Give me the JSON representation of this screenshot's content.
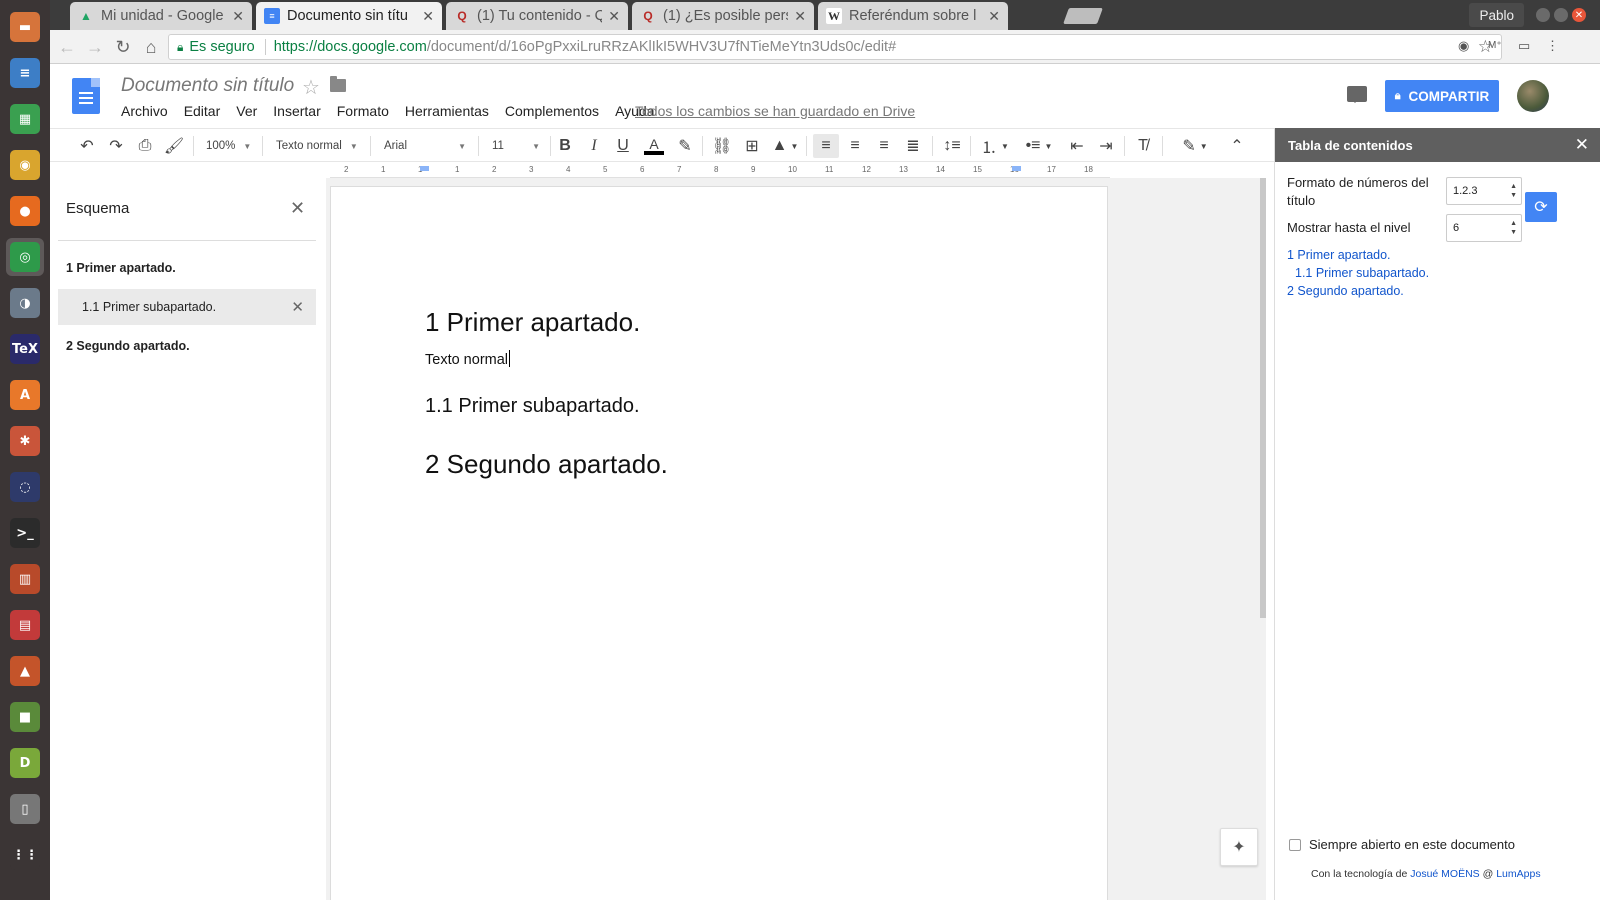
{
  "launcher": {
    "items": [
      {
        "icon": "files-icon",
        "glyph": "▬",
        "color": "#d6743b"
      },
      {
        "icon": "writer-icon",
        "glyph": "≡",
        "color": "#3d7ec6"
      },
      {
        "icon": "calc-icon",
        "glyph": "▦",
        "color": "#3aa050"
      },
      {
        "icon": "rhythmbox-icon",
        "glyph": "◉",
        "color": "#d9a52e"
      },
      {
        "icon": "firefox-icon",
        "glyph": "●",
        "color": "#e66a1f"
      },
      {
        "icon": "chrome-icon",
        "glyph": "◎",
        "color": "#2e9a4a"
      },
      {
        "icon": "earth-pro-icon",
        "glyph": "◑",
        "color": "#6b7a8a"
      },
      {
        "icon": "texmaker-icon",
        "glyph": "TeX",
        "color": "#2a2a6a"
      },
      {
        "icon": "software-center-icon",
        "glyph": "A",
        "color": "#e8782a"
      },
      {
        "icon": "settings-icon",
        "glyph": "✱",
        "color": "#c9553a"
      },
      {
        "icon": "geogebra-icon",
        "glyph": "◌",
        "color": "#2e3a6a"
      },
      {
        "icon": "terminal-icon",
        "glyph": ">_",
        "color": "#2b2b2b"
      },
      {
        "icon": "library-icon",
        "glyph": "▥",
        "color": "#b84a2a"
      },
      {
        "icon": "pdf-icon",
        "glyph": "▤",
        "color": "#c23a3a"
      },
      {
        "icon": "game-icon",
        "glyph": "▲",
        "color": "#c4542a"
      },
      {
        "icon": "minecraft-icon",
        "glyph": "■",
        "color": "#5a8a3a"
      },
      {
        "icon": "dia-icon",
        "glyph": "D",
        "color": "#7aa83a"
      },
      {
        "icon": "notes-icon",
        "glyph": "▯",
        "color": "#777777"
      },
      {
        "icon": "apps-grid-icon",
        "glyph": "⋮⋮",
        "color": "#3b3535"
      }
    ]
  },
  "tabs": [
    {
      "title": "Mi unidad - Google",
      "favicon": "drive-icon",
      "glyph": "▲",
      "fav_color": "#1fa463",
      "active": false
    },
    {
      "title": "Documento sin títu",
      "favicon": "docs-icon",
      "glyph": "≡",
      "fav_color": "#4285f4",
      "active": true
    },
    {
      "title": "(1) Tu contenido - Q",
      "favicon": "quora-icon",
      "glyph": "Q",
      "fav_color": "#b92b27",
      "active": false
    },
    {
      "title": "(1) ¿Es posible pers",
      "favicon": "quora-icon",
      "glyph": "Q",
      "fav_color": "#b92b27",
      "active": false
    },
    {
      "title": "Referéndum sobre l",
      "favicon": "wikipedia-icon",
      "glyph": "W",
      "fav_color": "#333333",
      "active": false
    }
  ],
  "browser": {
    "profile_name": "Pablo",
    "secure_label": "Es seguro",
    "url_host": "https://docs.google.com",
    "url_path": "/document/d/16oPgPxxiLruRRzAKlIkI5WHV3U7fNTieMeYtn3Uds0c/edit#"
  },
  "docs": {
    "title": "Documento sin título",
    "menu": [
      "Archivo",
      "Editar",
      "Ver",
      "Insertar",
      "Formato",
      "Herramientas",
      "Complementos",
      "Ayuda"
    ],
    "save_status": "Todos los cambios se han guardado en Drive",
    "share_label": "COMPARTIR"
  },
  "toolbar": {
    "zoom": "100%",
    "style": "Texto normal",
    "font": "Arial",
    "size": "11"
  },
  "ruler": {
    "labels": [
      "2",
      "1",
      "1",
      "1",
      "2",
      "3",
      "4",
      "5",
      "6",
      "7",
      "8",
      "9",
      "10",
      "11",
      "12",
      "13",
      "14",
      "15",
      "16",
      "17",
      "18"
    ]
  },
  "outline": {
    "title": "Esquema",
    "items": [
      {
        "text": "1 Primer apartado.",
        "bold": true,
        "selected": false
      },
      {
        "text": "1.1 Primer subapartado.",
        "bold": false,
        "selected": true
      },
      {
        "text": "2 Segundo apartado.",
        "bold": true,
        "selected": false
      }
    ]
  },
  "document": {
    "h1_first": "1 Primer apartado.",
    "body_text": "Texto normal",
    "h2_first": "1.1 Primer subapartado.",
    "h1_second": "2 Segundo apartado."
  },
  "toc": {
    "title": "Tabla de contenidos",
    "number_format_label": "Formato de números del título",
    "number_format_value": "1.2.3",
    "show_level_label": "Mostrar hasta el nivel",
    "show_level_value": "6",
    "links": [
      "1 Primer apartado.",
      "1.1 Primer subapartado.",
      "2 Segundo apartado."
    ],
    "always_open_label": "Siempre abierto en este documento",
    "credit_prefix": "Con la tecnología de",
    "credit_author": "Josué MOËNS",
    "credit_at": "@",
    "credit_company": "LumApps"
  }
}
